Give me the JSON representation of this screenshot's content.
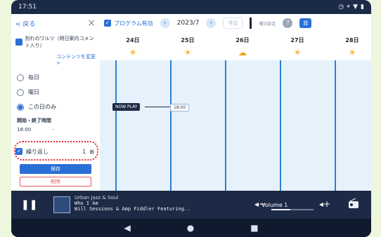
{
  "status": {
    "time": "17:51"
  },
  "left": {
    "back_label": "< 戻る",
    "program_title": "別れのワルツ（明日案内コメント入り）",
    "change_contents": "コンテンツを変更 >",
    "options": [
      "毎日",
      "曜日",
      "この日のみ"
    ],
    "time_label": "開始・終了時間",
    "time_value": "18:00",
    "repeat_label": "繰り返し",
    "repeat_count": "1",
    "save": "保存",
    "delete": "削除"
  },
  "header": {
    "program_enabled": "プログラム有効",
    "month": "2023/7",
    "today": "今日",
    "schedule_setting": "曜日設定",
    "days": [
      "24日",
      "25日",
      "26日",
      "27日",
      "28日"
    ]
  },
  "grid": {
    "now_play": "NOW PLAY",
    "start_time": "18:00"
  },
  "player": {
    "title": "Urban Jazz & Soul",
    "line1": "Who I Am",
    "line2": "Will Sessions & Amp Fiddler Featuring..",
    "volume_label": "Volume 1",
    "volume_level": 0.45
  }
}
